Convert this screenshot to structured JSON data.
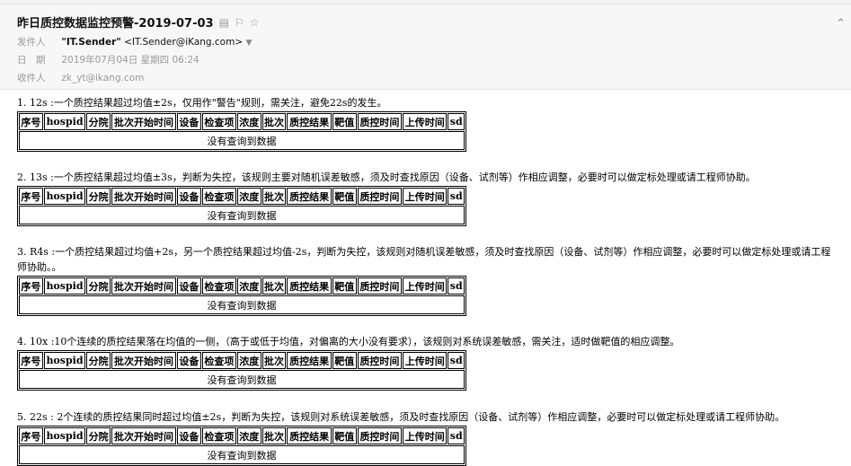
{
  "email": {
    "subject": "昨日质控数据监控预警-2019-07-03",
    "from_label": "发件人",
    "from_name": "\"IT.Sender\"",
    "from_addr": "<IT.Sender@iKang.com>",
    "date_label": "日　期",
    "date_value": "2019年07月04日 星期四 06:24",
    "to_label": "收件人",
    "to_value": "zk_yt@ikang.com"
  },
  "table": {
    "headers": [
      "序号",
      "hospid",
      "分院",
      "批次开始时间",
      "设备",
      "检查项",
      "浓度",
      "批次",
      "质控结果",
      "靶值",
      "质控时间",
      "上传时间",
      "sd"
    ],
    "empty_text": "没有查询到数据"
  },
  "rules": [
    {
      "text": "1. 12s :一个质控结果超过均值±2s，仅用作\"警告\"规则，需关注，避免22s的发生。"
    },
    {
      "text": "2. 13s :一个质控结果超过均值±3s，判断为失控，该规则主要对随机误差敏感，须及时查找原因（设备、试剂等）作相应调整，必要时可以做定标处理或请工程师协助。"
    },
    {
      "text": "3. R4s :一个质控结果超过均值+2s，另一个质控结果超过均值-2s，判断为失控，该规则对随机误差敏感，须及时查找原因（设备、试剂等）作相应调整，必要时可以做定标处理或请工程师协助。。"
    },
    {
      "text": "4. 10x :10个连续的质控结果落在均值的一侧，（高于或低于均值，对偏离的大小没有要求），该规则对系统误差敏感，需关注，适时做靶值的相应调整。"
    },
    {
      "text": "5. 22s : 2个连续的质控结果同时超过均值±2s，判断为失控，该规则对系统误差敏感，须及时查找原因（设备、试剂等）作相应调整，必要时可以做定标处理或请工程师协助。"
    }
  ]
}
